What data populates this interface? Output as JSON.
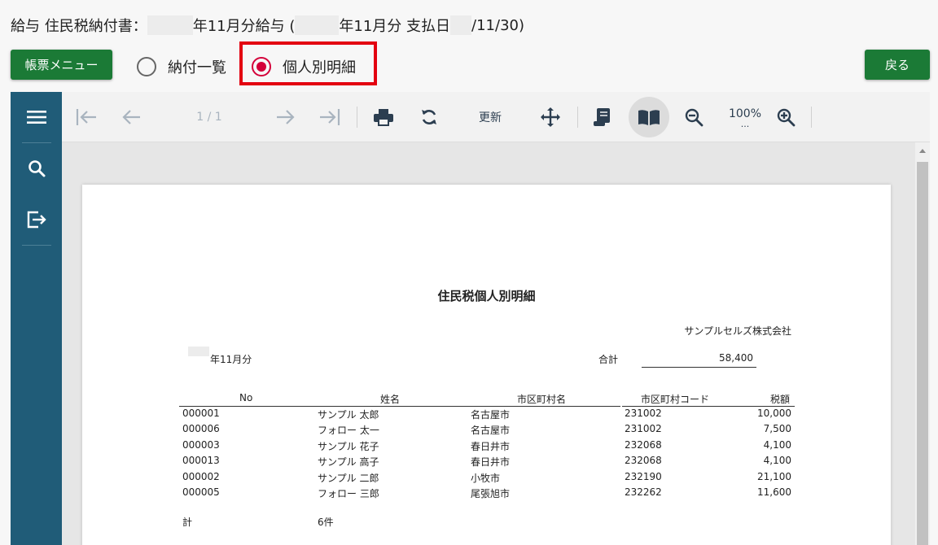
{
  "header": {
    "prefix": "給与 住民税納付書：",
    "part1": "年11月分給与 (",
    "part2": "年11月分 支払日",
    "part3": "/11/30)"
  },
  "buttons": {
    "report_menu": "帳票メニュー",
    "back": "戻る"
  },
  "radios": {
    "payment_list": "納付一覧",
    "individual_detail": "個人別明細",
    "selected": "individual_detail"
  },
  "toolbar": {
    "page_indicator": "1 / 1",
    "refresh_label": "更新",
    "zoom_level": "100%",
    "zoom_more": "..."
  },
  "report": {
    "title": "住民税個人別明細",
    "company": "サンプルセルズ株式会社",
    "month_label": "年11月分",
    "total_label": "合計",
    "total_value": "58,400",
    "columns": [
      "No",
      "姓名",
      "市区町村名",
      "市区町村コード",
      "税額"
    ],
    "rows": [
      {
        "no": "000001",
        "name": "サンプル 太郎",
        "city": "名古屋市",
        "code": "231002",
        "tax": "10,000"
      },
      {
        "no": "000006",
        "name": "フォロー 太一",
        "city": "名古屋市",
        "code": "231002",
        "tax": "7,500"
      },
      {
        "no": "000003",
        "name": "サンプル 花子",
        "city": "春日井市",
        "code": "232068",
        "tax": "4,100"
      },
      {
        "no": "000013",
        "name": "サンプル 高子",
        "city": "春日井市",
        "code": "232068",
        "tax": "4,100"
      },
      {
        "no": "000002",
        "name": "サンプル 二郎",
        "city": "小牧市",
        "code": "232190",
        "tax": "21,100"
      },
      {
        "no": "000005",
        "name": "フォロー 三郎",
        "city": "尾張旭市",
        "code": "232262",
        "tax": "11,600"
      }
    ],
    "footer_label": "計",
    "footer_count": "6件"
  }
}
